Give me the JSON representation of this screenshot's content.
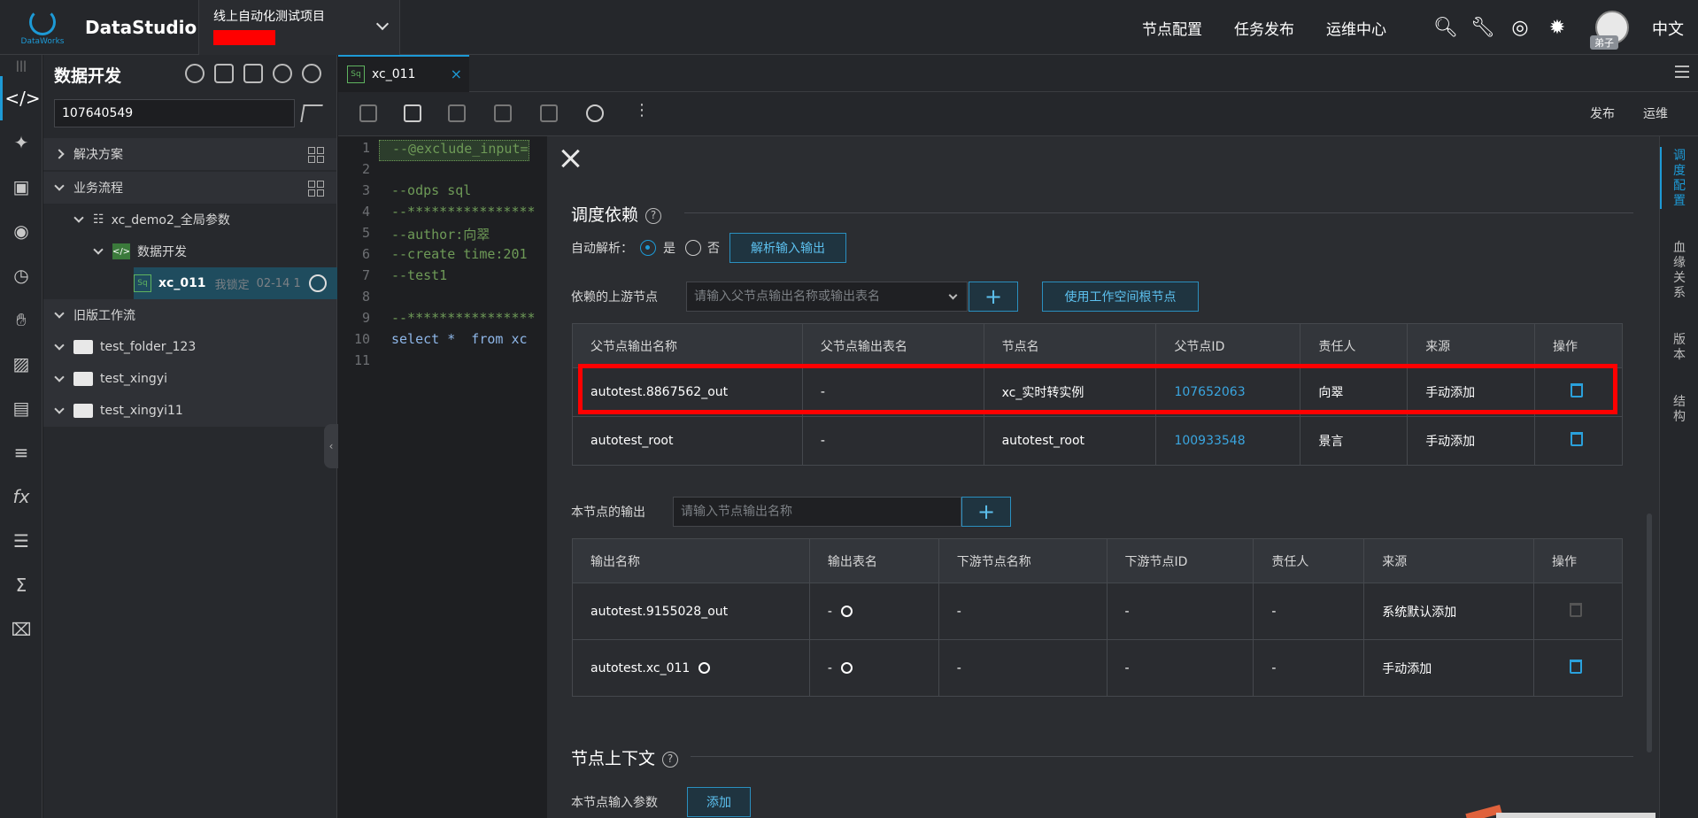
{
  "header": {
    "logo_text": "DataWorks",
    "app_title": "DataStudio",
    "project_name": "线上自动化测试项目",
    "nav": [
      "节点配置",
      "任务发布",
      "运维中心"
    ],
    "icons": [
      "search-icon",
      "wrench-icon",
      "headset-icon",
      "bug-icon"
    ],
    "avatar_tag": "弟子",
    "language": "中文"
  },
  "left_panel": {
    "title": "数据开发",
    "search_value": "107640549",
    "sections": {
      "solutions": "解决方案",
      "business_flow": "业务流程",
      "legacy_flow": "旧版工作流"
    },
    "tree": {
      "flow_name": "xc_demo2_全局参数",
      "data_dev": "数据开发",
      "node_name": "xc_011",
      "node_lock": "我锁定",
      "node_time": "02-14 1",
      "folders": [
        "test_folder_123",
        "test_xingyi",
        "test_xingyi11"
      ]
    }
  },
  "tab": {
    "name": "xc_011",
    "badge": "Sq",
    "close": "×"
  },
  "toolbar": {
    "publish": "发布",
    "ops": "运维"
  },
  "editor": {
    "lines": [
      {
        "n": "1",
        "code": "--@exclude_input="
      },
      {
        "n": "2",
        "code": ""
      },
      {
        "n": "3",
        "code": "--odps sql"
      },
      {
        "n": "4",
        "code": "--****************"
      },
      {
        "n": "5",
        "code": "--author:向翠"
      },
      {
        "n": "6",
        "code": "--create time:201"
      },
      {
        "n": "7",
        "code": "--test1"
      },
      {
        "n": "8",
        "code": ""
      },
      {
        "n": "9",
        "code": "--****************"
      },
      {
        "n": "10",
        "code": "select *  from xc"
      },
      {
        "n": "11",
        "code": ""
      }
    ]
  },
  "right_rail": {
    "tabs": [
      "调度配置",
      "血缘关系",
      "版本",
      "结构"
    ]
  },
  "config": {
    "dep_title": "调度依赖",
    "auto_parse_label": "自动解析：",
    "yes": "是",
    "no": "否",
    "parse_btn": "解析输入输出",
    "upstream_label": "依赖的上游节点",
    "upstream_placeholder": "请输入父节点输出名称或输出表名",
    "use_root_btn": "使用工作空间根节点",
    "upstream_headers": [
      "父节点输出名称",
      "父节点输出表名",
      "节点名",
      "父节点ID",
      "责任人",
      "来源",
      "操作"
    ],
    "upstream_rows": [
      {
        "out": "autotest.8867562_out",
        "table": "-",
        "node": "xc_实时转实例",
        "id": "107652063",
        "owner": "向翠",
        "src": "手动添加"
      },
      {
        "out": "autotest_root",
        "table": "-",
        "node": "autotest_root",
        "id": "100933548",
        "owner": "景言",
        "src": "手动添加"
      }
    ],
    "output_label": "本节点的输出",
    "output_placeholder": "请输入节点输出名称",
    "output_headers": [
      "输出名称",
      "输出表名",
      "下游节点名称",
      "下游节点ID",
      "责任人",
      "来源",
      "操作"
    ],
    "output_rows": [
      {
        "out": "autotest.9155028_out",
        "table": "-",
        "down_name": "-",
        "down_id": "-",
        "owner": "-",
        "src": "系统默认添加"
      },
      {
        "out": "autotest.xc_011",
        "table": "-",
        "down_name": "-",
        "down_id": "-",
        "owner": "-",
        "src": "手动添加"
      }
    ],
    "ctx_title": "节点上下文",
    "input_params_label": "本节点输入参数",
    "add_btn": "添加"
  }
}
